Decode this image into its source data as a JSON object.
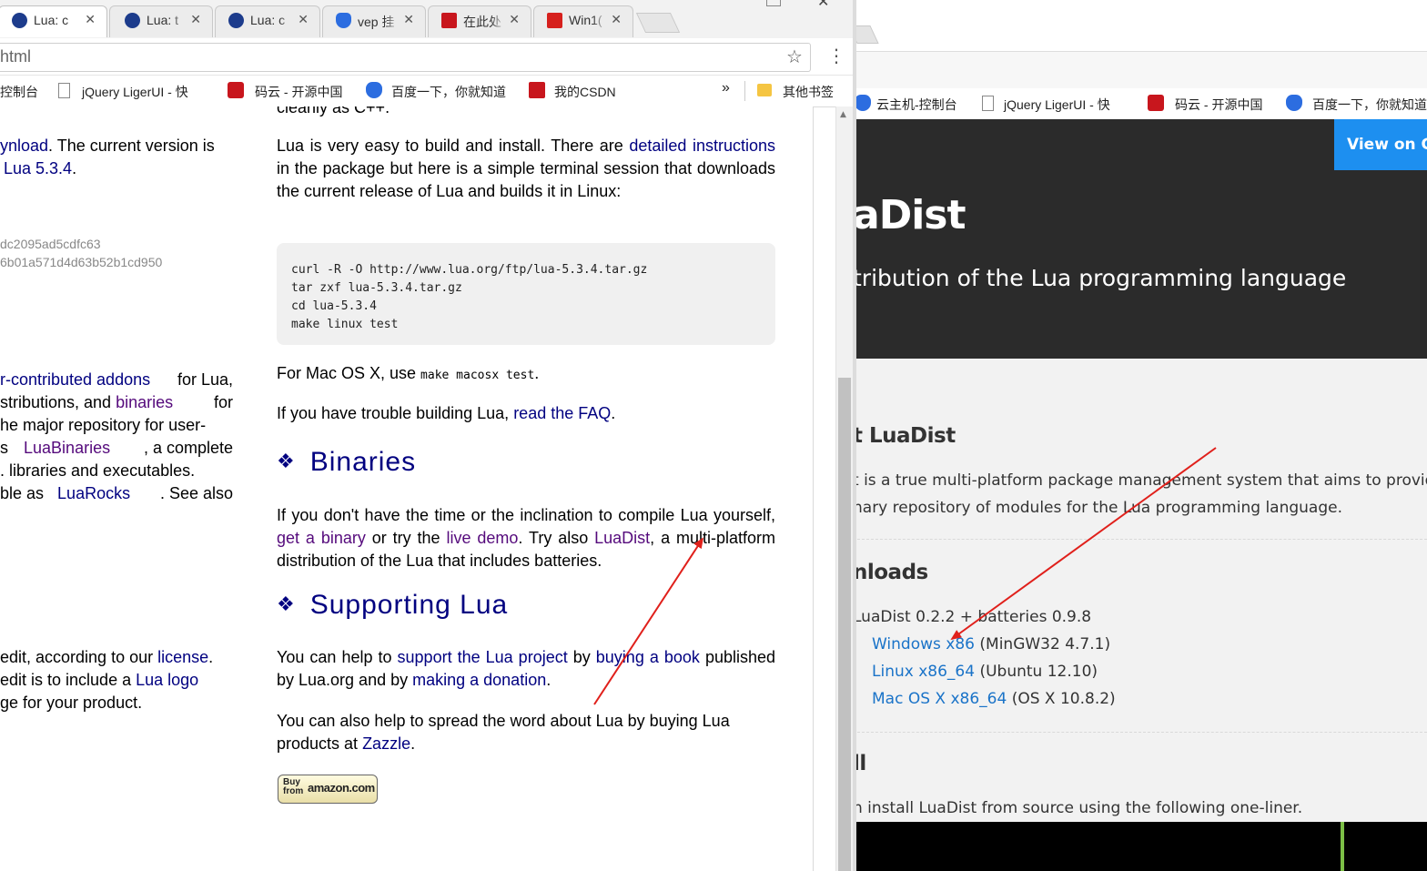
{
  "left_window": {
    "tabs": [
      {
        "label": "Lua: c",
        "icon": "lua-icon",
        "active": true
      },
      {
        "label": "Lua: t",
        "icon": "lua-icon",
        "active": false
      },
      {
        "label": "Lua: c",
        "icon": "lua-icon",
        "active": false
      },
      {
        "label": "vep 挂",
        "icon": "baidu-paw-icon",
        "active": false
      },
      {
        "label": "在此处",
        "icon": "csdn-icon",
        "active": false
      },
      {
        "label": "Win1(",
        "icon": "ithome-icon",
        "active": false
      }
    ],
    "close_glyph": "✕",
    "url": "html",
    "bookmarks": [
      {
        "label": "控制台",
        "icon": "console-icon"
      },
      {
        "label": "jQuery LigerUI - 快",
        "icon": "page-icon"
      },
      {
        "label": "码云 - 开源中国",
        "icon": "gitee-icon"
      },
      {
        "label": "百度一下，你就知道",
        "icon": "baidu-paw-icon"
      },
      {
        "label": "我的CSDN",
        "icon": "csdn-icon"
      }
    ],
    "bookmarks_overflow": "»",
    "other_bookmarks": "其他书签",
    "content": {
      "top_cut_text": "cleanly as C++.",
      "col1": {
        "p1_link": "ynload",
        "p1_text_a": ". The current version is",
        "p1_link2": "Lua 5.3.4",
        "p1_text_b": ".",
        "hash1": "dc2095ad5cdfc63",
        "hash2": "6b01a571d4d63b52b1cd950",
        "p2_link1": "r-contributed addons",
        "p2_text1": " for Lua,",
        "p2_text2": "stributions, and ",
        "p2_link2": "binaries",
        "p2_text3": " for",
        "p2_text4": "he major repository for user-",
        "p2_text5": "s ",
        "p2_link3": "LuaBinaries",
        "p2_text6": ", a complete",
        "p2_text7": ". libraries and executables.",
        "p2_text8": "ble as ",
        "p2_link4": "LuaRocks",
        "p2_text9": ". See also",
        "p3_text1": "edit, according to our ",
        "p3_link1": "license",
        "p3_text1b": ".",
        "p3_text2": "edit is to include a ",
        "p3_link2": "Lua logo",
        "p3_text3": "ge for your product."
      },
      "col2": {
        "build_text1": "Lua is very easy to build and install. There are ",
        "build_link1": "detailed instructions",
        "build_text2": " in the package but here is a simple terminal session that downloads the current release of Lua and builds it in Linux:",
        "code_lines": [
          "curl -R -O http://www.lua.org/ftp/lua-5.3.4.tar.gz",
          "tar zxf lua-5.3.4.tar.gz",
          "cd lua-5.3.4",
          "make linux test"
        ],
        "mac_text": "For Mac OS X, use ",
        "mac_code": "make macosx test",
        "mac_end": ".",
        "trouble_text": "If you have trouble building Lua, ",
        "trouble_link": "read the FAQ",
        "trouble_end": ".",
        "binaries_heading": "Binaries",
        "heading_glyph": "❖",
        "bin_text1": "If you don't have the time or the inclination to compile Lua yourself, ",
        "bin_link1": "get a binary",
        "bin_text2": " or try the ",
        "bin_link2": "live demo",
        "bin_text3": ". Try also ",
        "bin_link3": "LuaDist",
        "bin_text4": ", a multi-platform distribution of the Lua that includes batteries.",
        "supporting_heading": "Supporting Lua",
        "sup_text1": "You can help to ",
        "sup_link1": "support the Lua project",
        "sup_text2": " by ",
        "sup_link2": "buying a book",
        "sup_text3": " published by Lua.org and by ",
        "sup_link3": "making a donation",
        "sup_text4": ".",
        "spread_text": "You can also help to spread the word about Lua by buying Lua products at ",
        "spread_link": "Zazzle",
        "spread_end": ".",
        "amazon_buy": "Buy from",
        "amazon_brand": "amazon.com"
      }
    }
  },
  "right_window": {
    "bookmarks": [
      {
        "label": "云主机-控制台",
        "icon": "console-icon"
      },
      {
        "label": "jQuery LigerUI - 快",
        "icon": "page-icon"
      },
      {
        "label": "码云 - 开源中国",
        "icon": "gitee-icon"
      },
      {
        "label": "百度一下，你就知道",
        "icon": "baidu-paw-icon"
      }
    ],
    "view_on_button": "View on G",
    "hero_title": "aDist",
    "hero_subtitle": "tribution of the Lua programming language",
    "about_heading": "t LuaDist",
    "about_line1": "t is a true multi-platform package management system that aims to provide",
    "about_line2": "nary repository of modules for the Lua programming language.",
    "downloads_heading": "nloads",
    "downloads_version": "LuaDist 0.2.2 + batteries 0.9.8",
    "downloads": [
      {
        "link": "Windows x86",
        "note": "(MinGW32 4.7.1)"
      },
      {
        "link": "Linux x86_64",
        "note": "(Ubuntu 12.10)"
      },
      {
        "link": "Mac OS X x86_64",
        "note": "(OS X 10.8.2)"
      }
    ],
    "install_heading": "ll",
    "install_text": "n install LuaDist from source using the following one-liner."
  },
  "colors": {
    "link": "#000080",
    "visited_link": "#550a7c",
    "hero_bg": "#2b2b2b",
    "view_on_bg": "#1d8ff0",
    "right_link": "#1a73c8",
    "arrow": "#e0201b"
  }
}
